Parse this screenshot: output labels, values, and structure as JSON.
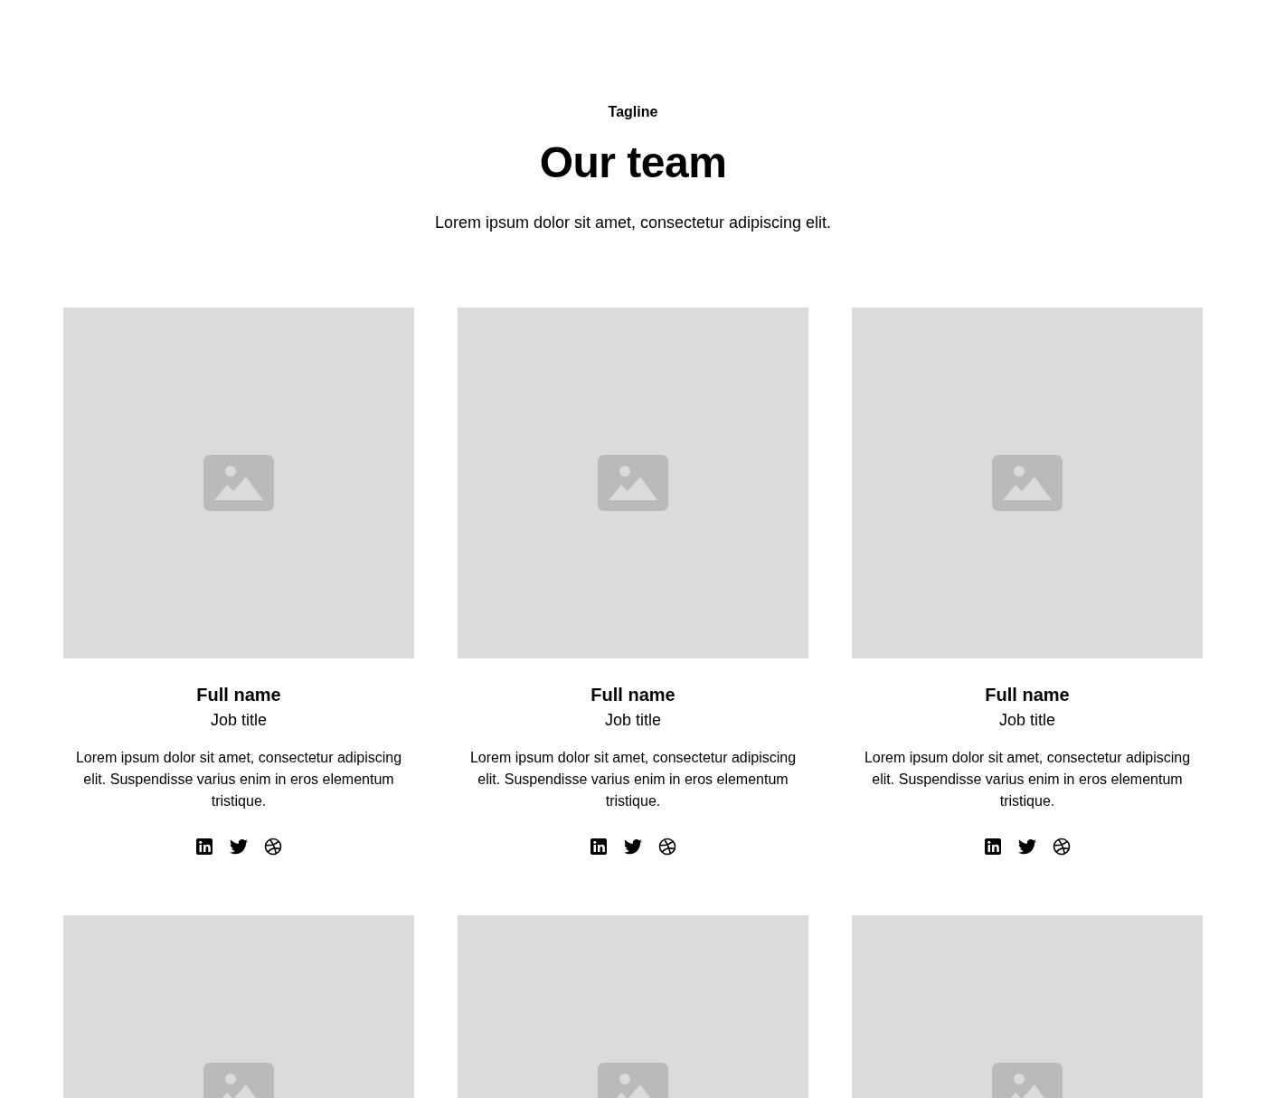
{
  "header": {
    "tagline": "Tagline",
    "title": "Our team",
    "subtitle": "Lorem ipsum dolor sit amet, consectetur adipiscing elit."
  },
  "members": [
    {
      "kind": "profile",
      "name": "Full name",
      "job_title": "Job title",
      "bio": "Lorem ipsum dolor sit amet, consectetur adipiscing elit. Suspendisse varius enim in eros elementum tristique.",
      "socials": [
        {
          "kind": "linkedin"
        },
        {
          "kind": "twitter"
        },
        {
          "kind": "dribbble"
        }
      ]
    },
    {
      "kind": "profile",
      "name": "Full name",
      "job_title": "Job title",
      "bio": "Lorem ipsum dolor sit amet, consectetur adipiscing elit. Suspendisse varius enim in eros elementum tristique.",
      "socials": [
        {
          "kind": "linkedin"
        },
        {
          "kind": "twitter"
        },
        {
          "kind": "dribbble"
        }
      ]
    },
    {
      "kind": "profile",
      "name": "Full name",
      "job_title": "Job title",
      "bio": "Lorem ipsum dolor sit amet, consectetur adipiscing elit. Suspendisse varius enim in eros elementum tristique.",
      "socials": [
        {
          "kind": "linkedin"
        },
        {
          "kind": "twitter"
        },
        {
          "kind": "dribbble"
        }
      ]
    },
    {
      "kind": "photo-only"
    },
    {
      "kind": "photo-only"
    },
    {
      "kind": "photo-only"
    }
  ]
}
